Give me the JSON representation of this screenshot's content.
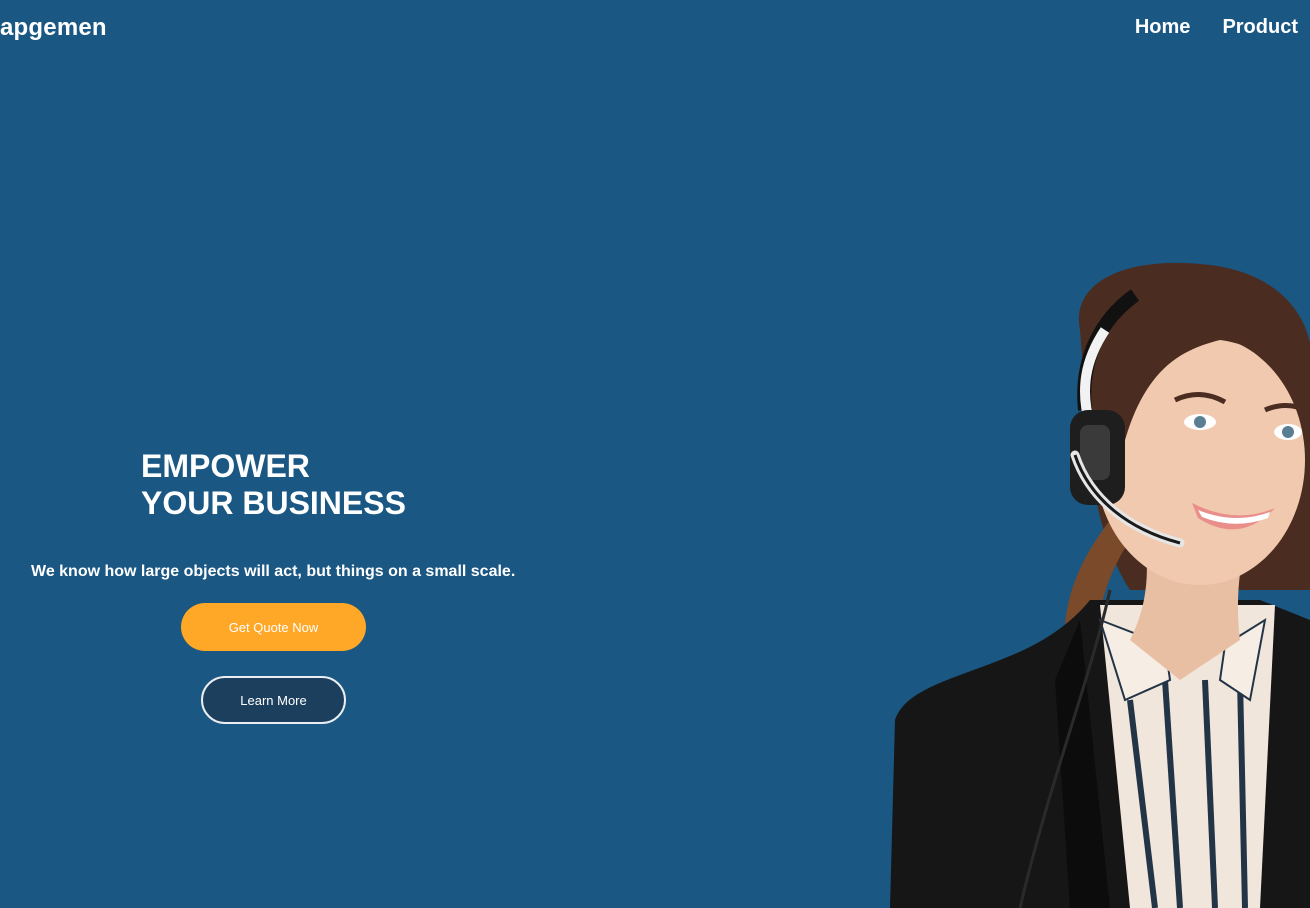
{
  "header": {
    "brand": "apgemen",
    "nav": [
      {
        "label": "Home"
      },
      {
        "label": "Product"
      }
    ]
  },
  "hero": {
    "title_line1": "EMPOWER",
    "title_line2": "YOUR BUSINESS",
    "subtitle": "We know how large objects will act, but things on a small scale.",
    "primary_button": "Get Quote Now",
    "secondary_button": "Learn More",
    "image": "woman-with-headset"
  },
  "colors": {
    "background": "#1a5782",
    "accent": "#ffa726",
    "secondary_button_bg": "#1d3f5e",
    "text": "#ffffff"
  }
}
